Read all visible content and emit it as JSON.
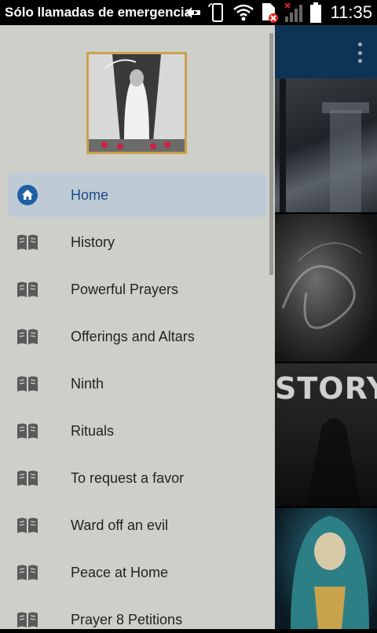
{
  "status_bar": {
    "carrier": "Sólo llamadas de emergencia",
    "time": "11:35",
    "icons": [
      "usb-debug-icon",
      "phone-rotate-icon",
      "wifi-icon",
      "no-sim-icon",
      "signal-icon",
      "battery-icon"
    ]
  },
  "app": {
    "toolbar_menu_icon": "overflow-menu-icon",
    "tile_text": "STORY"
  },
  "drawer": {
    "header_image_alt": "santa-muerte-image",
    "items": [
      {
        "label": "Home",
        "icon": "home-icon",
        "active": true
      },
      {
        "label": "History",
        "icon": "book-icon",
        "active": false
      },
      {
        "label": "Powerful Prayers",
        "icon": "book-icon",
        "active": false
      },
      {
        "label": "Offerings and Altars",
        "icon": "book-icon",
        "active": false
      },
      {
        "label": "Ninth",
        "icon": "book-icon",
        "active": false
      },
      {
        "label": "Rituals",
        "icon": "book-icon",
        "active": false
      },
      {
        "label": "To request a favor",
        "icon": "book-icon",
        "active": false
      },
      {
        "label": "Ward off an evil",
        "icon": "book-icon",
        "active": false
      },
      {
        "label": "Peace at Home",
        "icon": "book-icon",
        "active": false
      },
      {
        "label": "Prayer 8 Petitions",
        "icon": "book-icon",
        "active": false
      }
    ]
  },
  "colors": {
    "toolbar": "#0e3455",
    "drawer_bg": "#cfcfca",
    "active_bg": "#bfcbd4",
    "active_text": "#1a4a8c",
    "home_icon": "#1f5fa3",
    "book_icon": "#5a5a5a"
  }
}
